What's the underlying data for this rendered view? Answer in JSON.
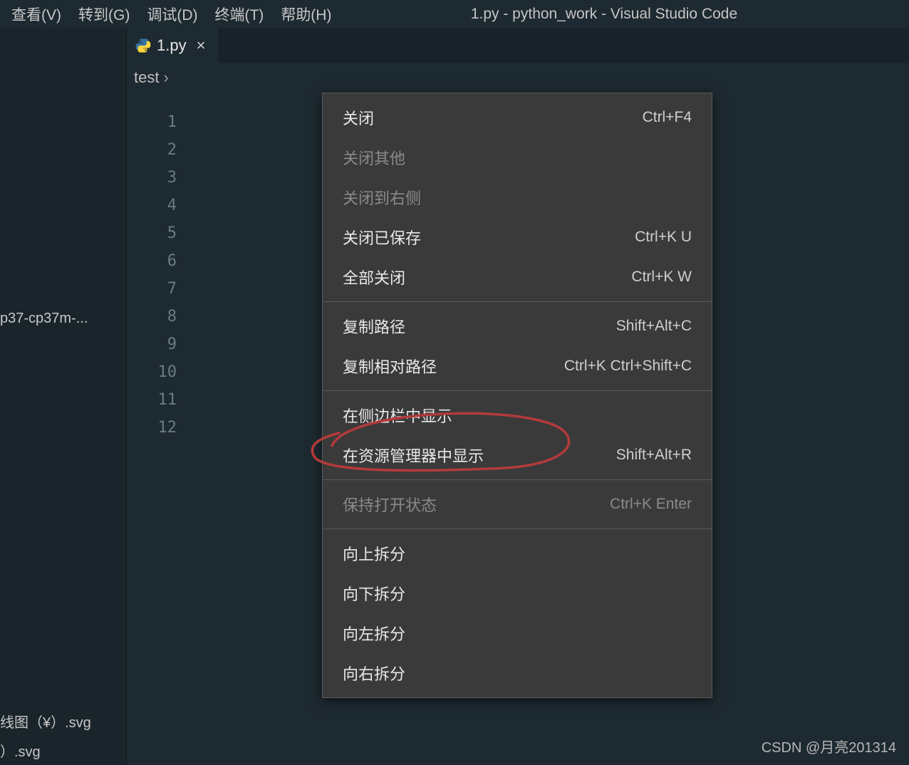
{
  "window": {
    "title": "1.py - python_work - Visual Studio Code"
  },
  "menubar": {
    "items": [
      {
        "label": "查看(V)"
      },
      {
        "label": "转到(G)"
      },
      {
        "label": "调试(D)"
      },
      {
        "label": "终端(T)"
      },
      {
        "label": "帮助(H)"
      }
    ]
  },
  "sidebar": {
    "top_item": "p37-cp37m-...",
    "bottom_items": [
      "线图（¥）.svg",
      "）.svg"
    ]
  },
  "tab": {
    "label": "1.py",
    "close_glyph": "×"
  },
  "breadcrumb": {
    "segment": "test",
    "chevron": "›"
  },
  "line_numbers": [
    "1",
    "2",
    "3",
    "4",
    "5",
    "6",
    "7",
    "8",
    "9",
    "10",
    "11",
    "12"
  ],
  "context_menu": {
    "items": [
      {
        "kind": "item",
        "label": "关闭",
        "shortcut": "Ctrl+F4",
        "disabled": false,
        "name": "menu-close"
      },
      {
        "kind": "item",
        "label": "关闭其他",
        "shortcut": "",
        "disabled": true,
        "name": "menu-close-others"
      },
      {
        "kind": "item",
        "label": "关闭到右侧",
        "shortcut": "",
        "disabled": true,
        "name": "menu-close-right"
      },
      {
        "kind": "item",
        "label": "关闭已保存",
        "shortcut": "Ctrl+K U",
        "disabled": false,
        "name": "menu-close-saved"
      },
      {
        "kind": "item",
        "label": "全部关闭",
        "shortcut": "Ctrl+K W",
        "disabled": false,
        "name": "menu-close-all"
      },
      {
        "kind": "sep"
      },
      {
        "kind": "item",
        "label": "复制路径",
        "shortcut": "Shift+Alt+C",
        "disabled": false,
        "name": "menu-copy-path"
      },
      {
        "kind": "item",
        "label": "复制相对路径",
        "shortcut": "Ctrl+K Ctrl+Shift+C",
        "disabled": false,
        "name": "menu-copy-relative-path"
      },
      {
        "kind": "sep"
      },
      {
        "kind": "item",
        "label": "在侧边栏中显示",
        "shortcut": "",
        "disabled": false,
        "name": "menu-reveal-sidebar"
      },
      {
        "kind": "item",
        "label": "在资源管理器中显示",
        "shortcut": "Shift+Alt+R",
        "disabled": false,
        "name": "menu-reveal-explorer"
      },
      {
        "kind": "sep"
      },
      {
        "kind": "item",
        "label": "保持打开状态",
        "shortcut": "Ctrl+K Enter",
        "disabled": true,
        "name": "menu-keep-open"
      },
      {
        "kind": "sep"
      },
      {
        "kind": "item",
        "label": "向上拆分",
        "shortcut": "",
        "disabled": false,
        "name": "menu-split-up"
      },
      {
        "kind": "item",
        "label": "向下拆分",
        "shortcut": "",
        "disabled": false,
        "name": "menu-split-down"
      },
      {
        "kind": "item",
        "label": "向左拆分",
        "shortcut": "",
        "disabled": false,
        "name": "menu-split-left"
      },
      {
        "kind": "item",
        "label": "向右拆分",
        "shortcut": "",
        "disabled": false,
        "name": "menu-split-right"
      }
    ]
  },
  "watermark": "CSDN @月亮201314"
}
